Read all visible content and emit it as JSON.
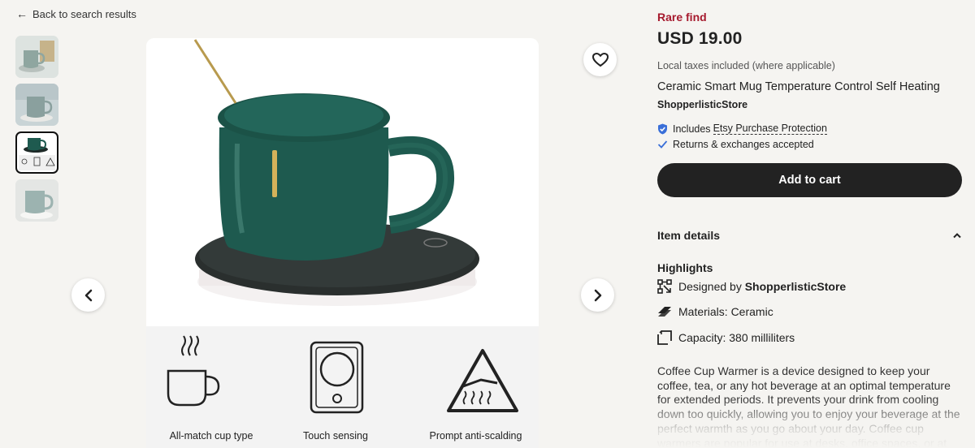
{
  "back_link": "Back to search results",
  "gallery": {
    "thumbnails": [
      "thumbnail-1",
      "thumbnail-2",
      "thumbnail-3",
      "thumbnail-4"
    ],
    "selected_index": 2,
    "features": [
      "All-match cup type",
      "Touch sensing",
      "Prompt anti-scalding"
    ]
  },
  "product": {
    "badge": "Rare find",
    "price": "USD 19.00",
    "taxes_note": "Local taxes included (where applicable)",
    "title": "Ceramic Smart Mug Temperature Control Self Heating",
    "shop": "ShopperlisticStore",
    "protection_prefix": "Includes",
    "protection_link": "Etsy Purchase Protection",
    "returns": "Returns & exchanges accepted",
    "add_to_cart": "Add to cart"
  },
  "details": {
    "header": "Item details",
    "highlights_title": "Highlights",
    "designed_by_label": "Designed by",
    "designed_by_shop": "ShopperlisticStore",
    "materials": "Materials: Ceramic",
    "capacity": "Capacity: 380 milliliters",
    "description": "Coffee Cup Warmer is a device designed to keep your coffee, tea, or any hot beverage at an optimal temperature for extended periods. It prevents your drink from cooling down too quickly, allowing you to enjoy your beverage at the perfect warmth as you go about your day. Coffee cup warmers are popular for use at desks, office spaces, or at home, especially"
  },
  "colors": {
    "rare_find": "#a61a2e",
    "cart_button": "#222222",
    "mug_green": "#1e5a4f",
    "background": "#f5f4f1",
    "shield_blue": "#3a6fd8"
  },
  "icons": {
    "back": "arrow-left-icon",
    "favorite": "heart-icon",
    "prev": "chevron-left-icon",
    "next": "chevron-right-icon",
    "protection": "shield-check-icon",
    "returns": "checkmark-icon",
    "collapse": "chevron-up-icon",
    "designed_by": "design-tool-icon",
    "materials": "material-icon",
    "capacity": "capacity-icon"
  }
}
